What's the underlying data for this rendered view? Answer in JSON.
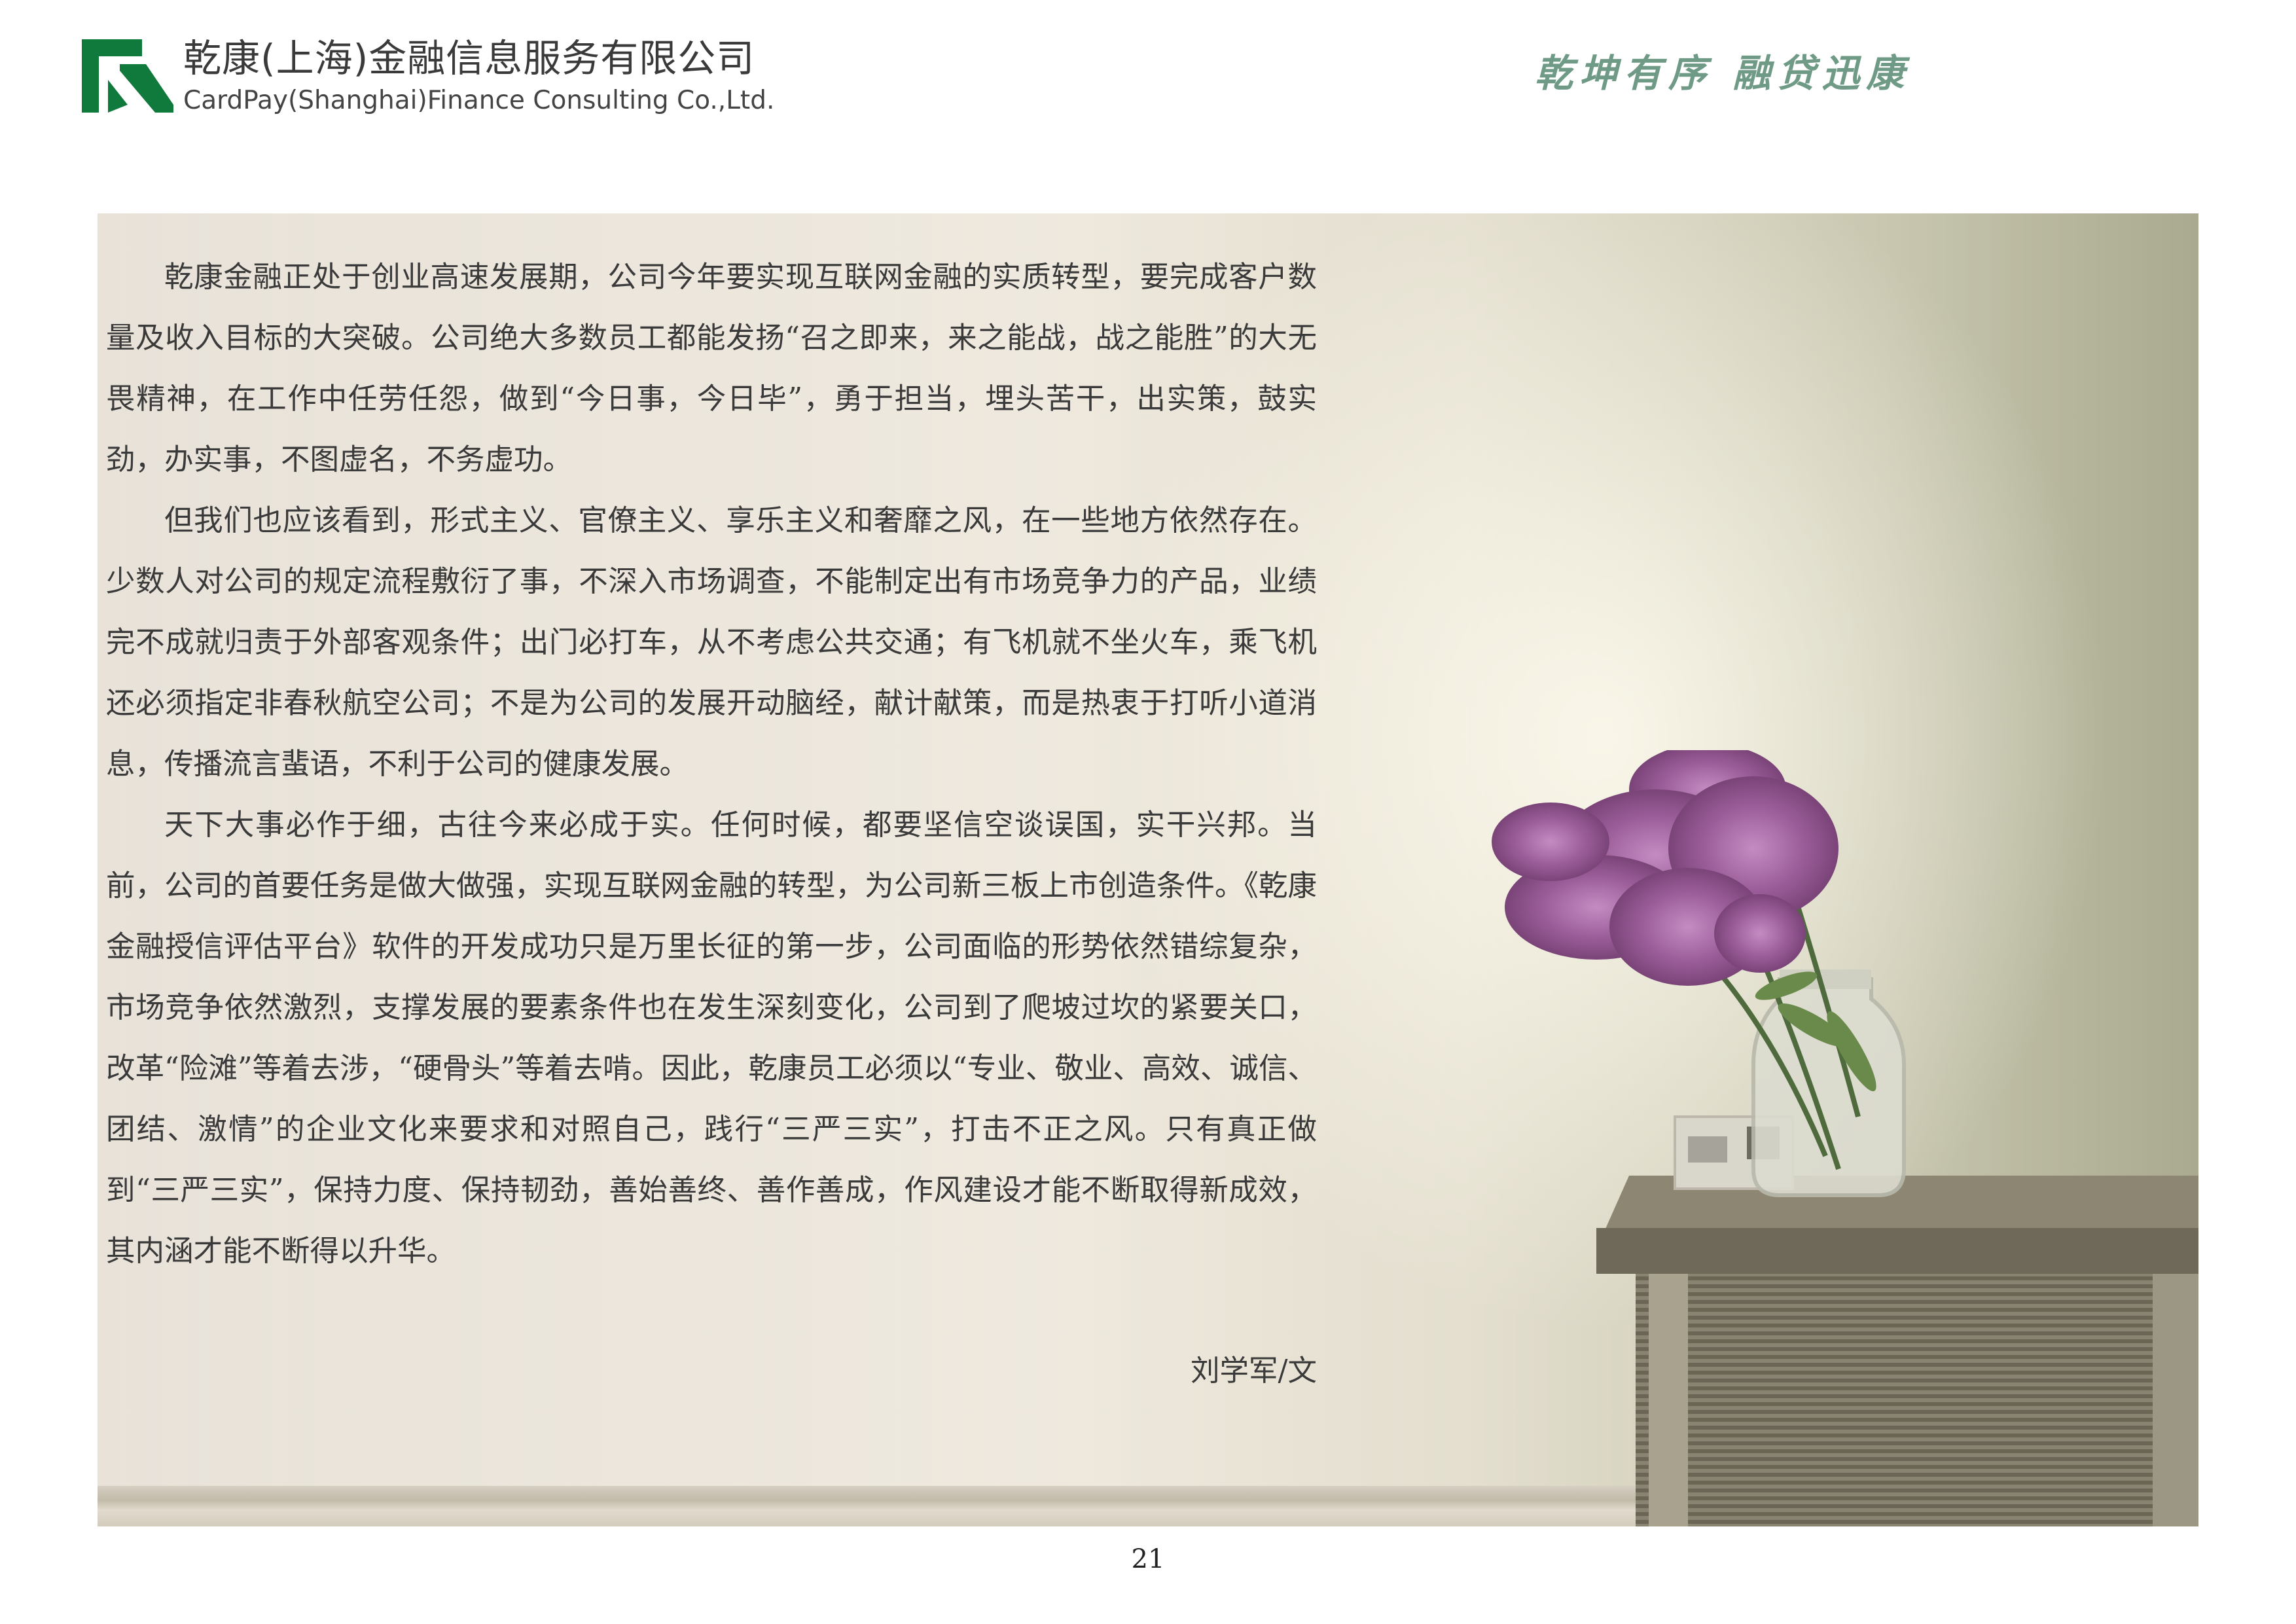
{
  "header": {
    "company_name_cn": "乾康(上海)金融信息服务有限公司",
    "company_name_en": "CardPay(Shanghai)Finance Consulting Co.,Ltd.",
    "slogan": "乾坤有序 融贷迅康",
    "logo_icon": "company-logo-icon",
    "brand_color": "#0f7a3c",
    "slogan_color": "#6f9a86"
  },
  "article": {
    "paragraphs": [
      "乾康金融正处于创业高速发展期，公司今年要实现互联网金融的实质转型，要完成客户数量及收入目标的大突破。公司绝大多数员工都能发扬“召之即来，来之能战，战之能胜”的大无畏精神，在工作中任劳任怨，做到“今日事，今日毕”，勇于担当，埋头苦干，出实策，鼓实劲，办实事，不图虚名，不务虚功。",
      "但我们也应该看到，形式主义、官僚主义、享乐主义和奢靡之风，在一些地方依然存在。少数人对公司的规定流程敷衍了事，不深入市场调查，不能制定出有市场竞争力的产品，业绩完不成就归责于外部客观条件；出门必打车，从不考虑公共交通；有飞机就不坐火车，乘飞机还必须指定非春秋航空公司；不是为公司的发展开动脑经，献计献策，而是热衷于打听小道消息，传播流言蜚语，不利于公司的健康发展。",
      "天下大事必作于细，古往今来必成于实。任何时候，都要坚信空谈误国，实干兴邦。当前，公司的首要任务是做大做强，实现互联网金融的转型，为公司新三板上市创造条件。《乾康金融授信评估平台》软件的开发成功只是万里长征的第一步，公司面临的形势依然错综复杂，市场竞争依然激烈，支撑发展的要素条件也在发生深刻变化，公司到了爬坡过坎的紧要关口，改革“险滩”等着去涉，“硬骨头”等着去啃。因此，乾康员工必须以“专业、敬业、高效、诚信、团结、激情”的企业文化来要求和对照自己，践行“三严三实”，打击不正之风。只有真正做到“三严三实”，保持力度、保持韧劲，善始善终、善作善成，作风建设才能不断取得新成效，其内涵才能不断得以升华。"
    ],
    "author": "刘学军/文"
  },
  "footer": {
    "page_number": "21"
  },
  "image": {
    "subject": "lilac-vase-photo"
  }
}
